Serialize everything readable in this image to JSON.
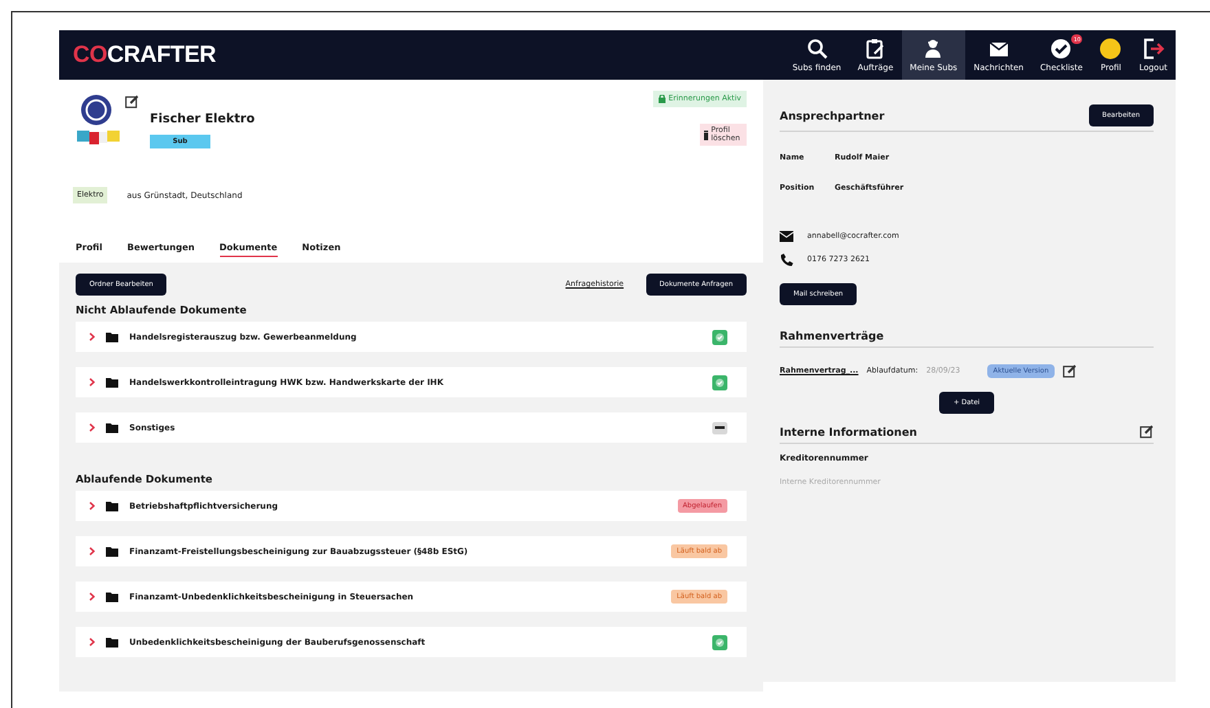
{
  "nav": {
    "logo_accent": "CO",
    "logo_rest": "CRAFTER",
    "items": [
      {
        "label": "Subs finden",
        "selected": false
      },
      {
        "label": "Aufträge",
        "selected": false
      },
      {
        "label": "Meine Subs",
        "selected": true
      },
      {
        "label": "Nachrichten",
        "selected": false
      },
      {
        "label": "Checkliste",
        "selected": false,
        "badge": "10"
      },
      {
        "label": "Profil",
        "selected": false
      },
      {
        "label": "Logout",
        "selected": false
      }
    ]
  },
  "profile": {
    "name": "Fischer Elektro",
    "type_badge": "Sub",
    "trade_tag": "Elektro",
    "location": "aus Grünstadt, Deutschland",
    "reminder": "Erinnerungen Aktiv",
    "delete_button": "Profil löschen"
  },
  "tabs": [
    {
      "label": "Profil",
      "selected": false
    },
    {
      "label": "Bewertungen",
      "selected": false
    },
    {
      "label": "Dokumente",
      "selected": true
    },
    {
      "label": "Notizen",
      "selected": false
    }
  ],
  "toolbar": {
    "edit_folders": "Ordner Bearbeiten",
    "history_link": "Anfragehistorie",
    "request_button": "Dokumente Anfragen"
  },
  "sections": [
    {
      "title": "Nicht Ablaufende Dokumente",
      "documents": [
        {
          "name": "Handelsregisterauszug bzw. Gewerbeanmeldung",
          "kind": "ok"
        },
        {
          "name": "Handelswerkkontrolleintragung HWK bzw. Handwerkskarte der IHK",
          "kind": "ok"
        },
        {
          "name": "Sonstiges",
          "kind": "none"
        }
      ]
    },
    {
      "title": "Ablaufende Dokumente",
      "documents": [
        {
          "name": "Betriebshaftpflichtversicherung",
          "kind": "expired",
          "label": "Abgelaufen"
        },
        {
          "name": "Finanzamt-Freistellungsbescheinigung zur Bauabzugssteuer (§48b EStG)",
          "kind": "soon",
          "label": "Läuft bald ab"
        },
        {
          "name": "Finanzamt-Unbedenklichkeitsbescheinigung in Steuersachen",
          "kind": "soon",
          "label": "Läuft bald ab"
        },
        {
          "name": "Unbedenklichkeitsbescheinigung der Bauberufsgenossenschaft",
          "kind": "ok"
        }
      ]
    }
  ],
  "contact": {
    "title": "Ansprechpartner",
    "edit_button": "Bearbeiten",
    "fields": [
      {
        "label": "Name",
        "value": "Rudolf Maier"
      },
      {
        "label": "Position",
        "value": "Geschäftsführer"
      }
    ],
    "email": "annabell@cocrafter.com",
    "phone": "0176 7273 2621",
    "mail_button": "Mail schreiben"
  },
  "contracts": {
    "title": "Rahmenverträge",
    "file_link": "Rahmenvertrag_...",
    "expiry_label": "Ablaufdatum:",
    "expiry_date": "28/09/23",
    "version_badge": "Aktuelle Version",
    "add_button": "+ Datei"
  },
  "internal": {
    "title": "Interne Informationen",
    "field_label": "Kreditorennummer",
    "placeholder": "Interne Kreditorennummer"
  }
}
